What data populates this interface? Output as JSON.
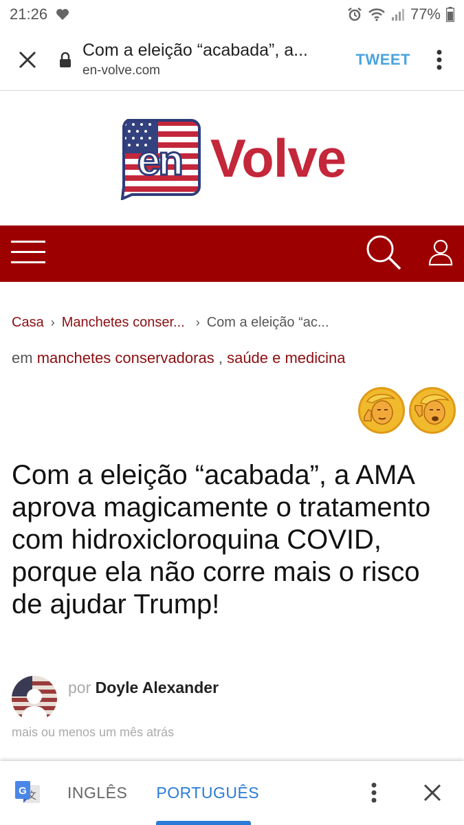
{
  "status_bar": {
    "time": "21:26",
    "battery": "77%"
  },
  "tab_bar": {
    "page_title": "Com a eleição “acabada”, a...",
    "domain": "en-volve.com",
    "tweet_label": "TWEET"
  },
  "logo": {
    "badge_text": "en",
    "word": "Volve"
  },
  "breadcrumb": {
    "home": "Casa",
    "section": "Manchetes conser...",
    "current": "Com a eleição “ac..."
  },
  "categories": {
    "prefix": "em",
    "category_1": "manchetes conservadoras",
    "separator": " ,",
    "category_2": "saúde e medicina"
  },
  "article": {
    "headline": "Com a eleição “acabada”, a AMA aprova magicamente o tratamento com hidroxicloroquina COVID, porque ela não corre mais o risco de ajudar Trump!",
    "by_prefix": "por",
    "author": "Doyle Alexander",
    "date": "mais ou menos um mês atrás"
  },
  "translate_bar": {
    "lang_source": "INGLÊS",
    "lang_target": "PORTUGUÊS"
  },
  "colors": {
    "nav_red": "#9d0000",
    "link_red": "#8b0e12",
    "logo_red": "#c4263a",
    "tweet_blue": "#4aa3df",
    "translate_blue": "#2a7ad6"
  }
}
